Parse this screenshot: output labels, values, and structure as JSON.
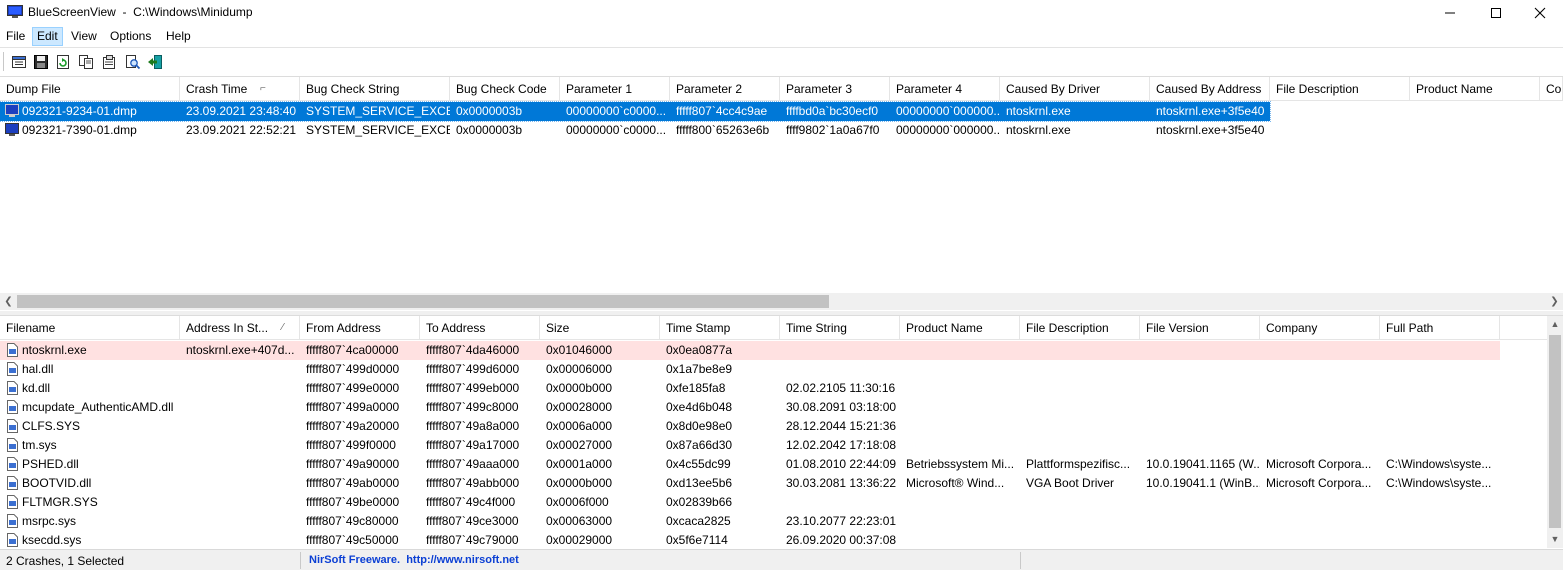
{
  "window": {
    "title": "BlueScreenView  -  C:\\Windows\\Minidump"
  },
  "menu": [
    "File",
    "Edit",
    "View",
    "Options",
    "Help"
  ],
  "menu_active": "Edit",
  "toolbar": {
    "icons": [
      "properties-icon",
      "save-icon",
      "refresh-icon",
      "copy-icon",
      "html-report-icon",
      "find-icon",
      "exit-icon"
    ]
  },
  "crash_list": {
    "columns": [
      "Dump File",
      "Crash Time",
      "Bug Check String",
      "Bug Check Code",
      "Parameter 1",
      "Parameter 2",
      "Parameter 3",
      "Parameter 4",
      "Caused By Driver",
      "Caused By Address",
      "File Description",
      "Product Name",
      "Co"
    ],
    "rows": [
      [
        "092321-9234-01.dmp",
        "23.09.2021 23:48:40",
        "SYSTEM_SERVICE_EXCEP...",
        "0x0000003b",
        "00000000`c0000...",
        "fffff807`4cc4c9ae",
        "ffffbd0a`bc30ecf0",
        "00000000`000000...",
        "ntoskrnl.exe",
        "ntoskrnl.exe+3f5e40",
        "",
        "",
        ""
      ],
      [
        "092321-7390-01.dmp",
        "23.09.2021 22:52:21",
        "SYSTEM_SERVICE_EXCEP...",
        "0x0000003b",
        "00000000`c0000...",
        "fffff800`65263e6b",
        "ffff9802`1a0a67f0",
        "00000000`000000...",
        "ntoskrnl.exe",
        "ntoskrnl.exe+3f5e40",
        "",
        "",
        ""
      ]
    ]
  },
  "driver_list": {
    "columns": [
      "Filename",
      "Address In St...",
      "From Address",
      "To Address",
      "Size",
      "Time Stamp",
      "Time String",
      "Product Name",
      "File Description",
      "File Version",
      "Company",
      "Full Path"
    ],
    "rows": [
      [
        "ntoskrnl.exe",
        "ntoskrnl.exe+407d...",
        "fffff807`4ca00000",
        "fffff807`4da46000",
        "0x01046000",
        "0x0ea0877a",
        "",
        "",
        "",
        "",
        "",
        ""
      ],
      [
        "hal.dll",
        "",
        "fffff807`499d0000",
        "fffff807`499d6000",
        "0x00006000",
        "0x1a7be8e9",
        "",
        "",
        "",
        "",
        "",
        ""
      ],
      [
        "kd.dll",
        "",
        "fffff807`499e0000",
        "fffff807`499eb000",
        "0x0000b000",
        "0xfe185fa8",
        "02.02.2105 11:30:16",
        "",
        "",
        "",
        "",
        ""
      ],
      [
        "mcupdate_AuthenticAMD.dll",
        "",
        "fffff807`499a0000",
        "fffff807`499c8000",
        "0x00028000",
        "0xe4d6b048",
        "30.08.2091 03:18:00",
        "",
        "",
        "",
        "",
        ""
      ],
      [
        "CLFS.SYS",
        "",
        "fffff807`49a20000",
        "fffff807`49a8a000",
        "0x0006a000",
        "0x8d0e98e0",
        "28.12.2044 15:21:36",
        "",
        "",
        "",
        "",
        ""
      ],
      [
        "tm.sys",
        "",
        "fffff807`499f0000",
        "fffff807`49a17000",
        "0x00027000",
        "0x87a66d30",
        "12.02.2042 17:18:08",
        "",
        "",
        "",
        "",
        ""
      ],
      [
        "PSHED.dll",
        "",
        "fffff807`49a90000",
        "fffff807`49aaa000",
        "0x0001a000",
        "0x4c55dc99",
        "01.08.2010 22:44:09",
        "Betriebssystem Mi...",
        "Plattformspezifisc...",
        "10.0.19041.1165 (W...",
        "Microsoft Corpora...",
        "C:\\Windows\\syste..."
      ],
      [
        "BOOTVID.dll",
        "",
        "fffff807`49ab0000",
        "fffff807`49abb000",
        "0x0000b000",
        "0xd13ee5b6",
        "30.03.2081 13:36:22",
        "Microsoft® Wind...",
        "VGA Boot Driver",
        "10.0.19041.1 (WinB...",
        "Microsoft Corpora...",
        "C:\\Windows\\syste..."
      ],
      [
        "FLTMGR.SYS",
        "",
        "fffff807`49be0000",
        "fffff807`49c4f000",
        "0x0006f000",
        "0x02839b66",
        "",
        "",
        "",
        "",
        "",
        ""
      ],
      [
        "msrpc.sys",
        "",
        "fffff807`49c80000",
        "fffff807`49ce3000",
        "0x00063000",
        "0xcaca2825",
        "23.10.2077 22:23:01",
        "",
        "",
        "",
        "",
        ""
      ],
      [
        "ksecdd.sys",
        "",
        "fffff807`49c50000",
        "fffff807`49c79000",
        "0x00029000",
        "0x5f6e7114",
        "26.09.2020 00:37:08",
        "",
        "",
        "",
        "",
        ""
      ]
    ]
  },
  "status": {
    "summary": "2 Crashes, 1 Selected",
    "link": "NirSoft Freeware.  http://www.nirsoft.net"
  },
  "colors": {
    "selection": "#0078d7",
    "highlight_row": "#ffe1e1",
    "link": "#0b3fd4"
  }
}
